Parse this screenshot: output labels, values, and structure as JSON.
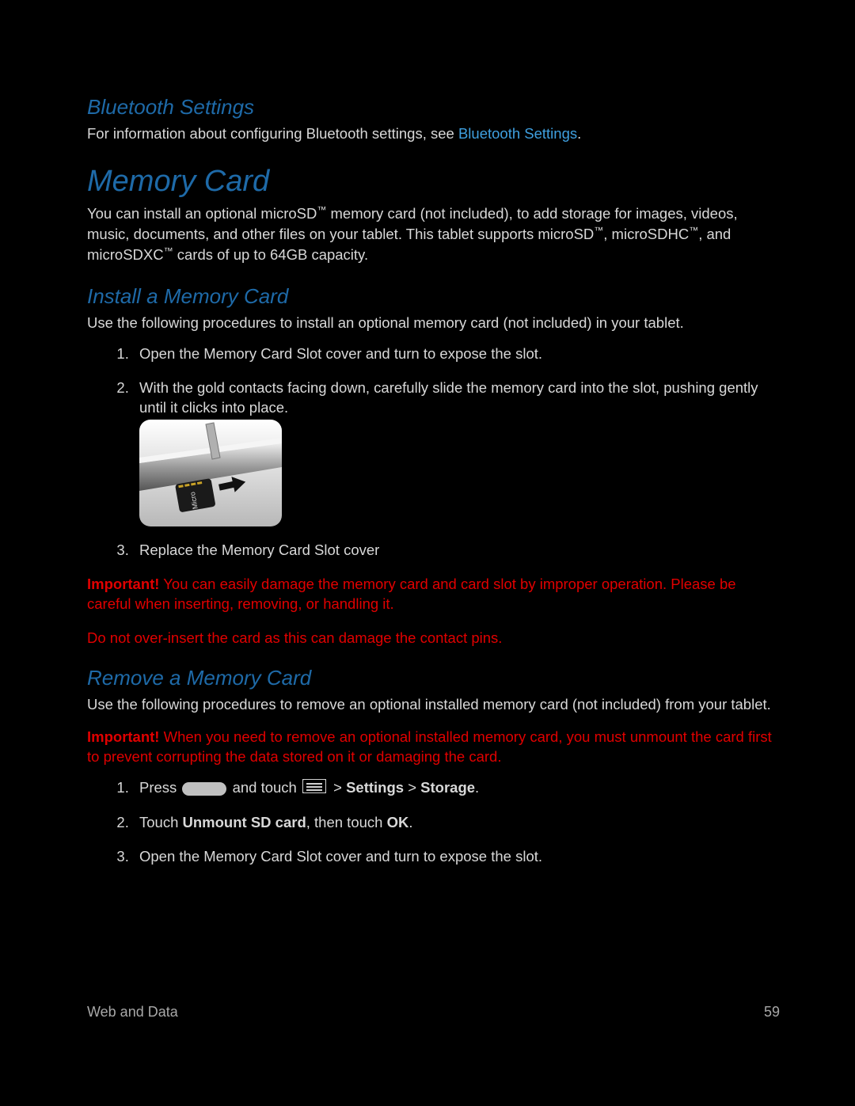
{
  "sections": {
    "bluetooth": {
      "heading": "Bluetooth Settings",
      "text_a": "For information about configuring Bluetooth settings, see ",
      "link": "Bluetooth Settings",
      "text_b": "."
    },
    "memory": {
      "heading": "Memory Card",
      "p1_a": "You can install an optional microSD",
      "p1_b": " memory card (not included), to add storage for images, videos, music, documents, and other files on your tablet. This tablet supports microSD",
      "p1_c": ", microSDHC",
      "p1_d": ", and microSDXC",
      "p1_e": " cards of up to 64GB capacity.",
      "tm": "™"
    },
    "install": {
      "heading": "Install a Memory Card",
      "intro": "Use the following procedures to install an optional memory card (not included) in your tablet.",
      "steps": {
        "s1": "Open the Memory Card Slot cover and turn to expose the slot.",
        "s2": "With the gold contacts facing down, carefully slide the memory card into the slot, pushing gently until it clicks into place.",
        "s3": "Replace the Memory Card Slot cover"
      },
      "warn1_label": "Important!",
      "warn1_text": " You can easily damage the memory card and card slot by improper operation. Please be careful when inserting, removing, or handling it.",
      "warn2": "Do not over-insert the card as this can damage the contact pins."
    },
    "remove": {
      "heading": "Remove a Memory Card",
      "intro": "Use the following procedures to remove an optional installed memory card (not included) from your tablet.",
      "warn_label": "Important!",
      "warn_text": " When you need to remove an optional installed memory card, you must unmount the card first to prevent corrupting the data stored on it or damaging the card.",
      "steps": {
        "s1_a": "Press ",
        "s1_b": " and touch ",
        "s1_c": " > ",
        "s1_settings": "Settings",
        "s1_gt": " > ",
        "s1_storage": "Storage",
        "s1_end": ".",
        "s2_a": "Touch ",
        "s2_b": "Unmount SD card",
        "s2_c": ", then touch ",
        "s2_d": "OK",
        "s2_e": ".",
        "s3": "Open the Memory Card Slot cover and turn to expose the slot."
      }
    }
  },
  "footer": {
    "section": "Web and Data",
    "page": "59"
  }
}
